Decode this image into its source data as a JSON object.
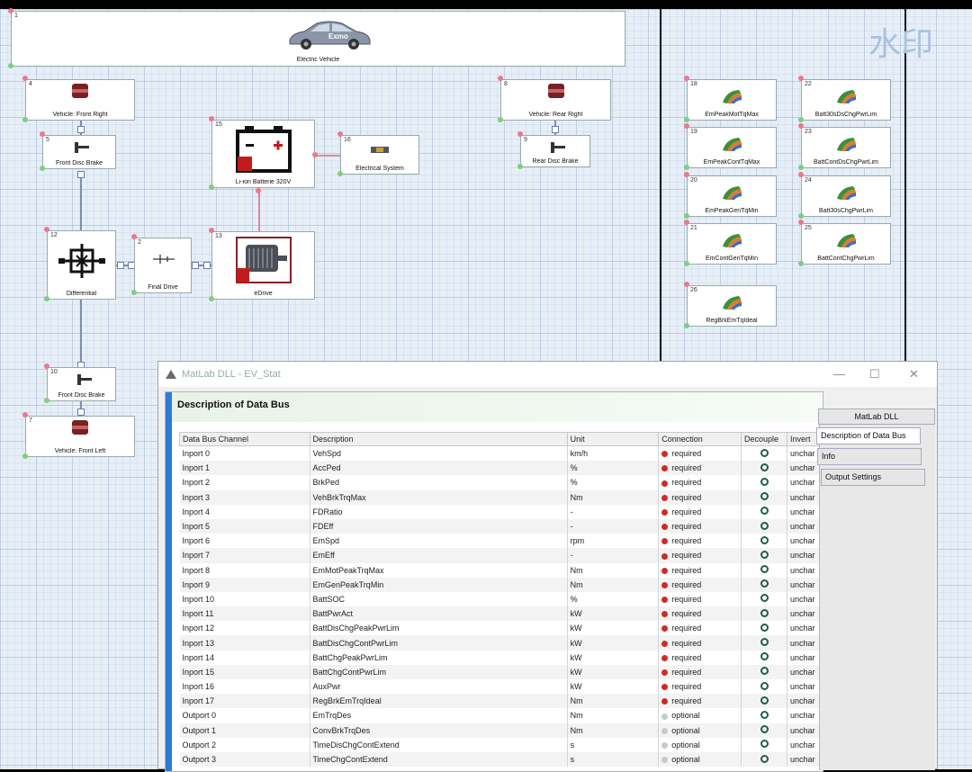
{
  "canvas": {
    "watermark": "水印",
    "top_banner": {
      "num": "1",
      "label": "Electric Vehicle",
      "car_text": "Exmo"
    },
    "blocks": [
      {
        "num": "4",
        "label": "Vehicle: Front Right"
      },
      {
        "num": "5",
        "label": "Front Disc Brake"
      },
      {
        "num": "8",
        "label": "Vehicle: Rear Right"
      },
      {
        "num": "9",
        "label": "Rear Disc Brake"
      },
      {
        "num": "15",
        "label": "Li-ion Batterie 320V"
      },
      {
        "num": "16",
        "label": "Electrical System"
      },
      {
        "num": "12",
        "label": "Differential"
      },
      {
        "num": "2",
        "label": "Final Drive"
      },
      {
        "num": "13",
        "label": "eDrive"
      },
      {
        "num": "10",
        "label": "Front Disc Brake"
      },
      {
        "num": "7",
        "label": "Vehicle: Front Left"
      }
    ],
    "logic_blocks": [
      {
        "num": "18",
        "label": "EmPeakMotTqMax"
      },
      {
        "num": "22",
        "label": "Batt30sDsChgPwrLim"
      },
      {
        "num": "19",
        "label": "EmPeakContTqMax"
      },
      {
        "num": "23",
        "label": "BattContDsChgPwrLim"
      },
      {
        "num": "20",
        "label": "EmPeakGenTqMin"
      },
      {
        "num": "24",
        "label": "Batt30sChgPwrLim"
      },
      {
        "num": "21",
        "label": "EmContGenTqMin"
      },
      {
        "num": "25",
        "label": "BattContChgPwrLim"
      },
      {
        "num": "26",
        "label": "RegBrkEmTqIdeal"
      }
    ]
  },
  "dialog": {
    "title": "MatLab DLL - EV_Stat",
    "heading": "Description of Data Bus",
    "tabs": [
      "MatLab DLL",
      "Description of Data Bus",
      "Info",
      "Output Settings"
    ],
    "columns": [
      "Data Bus Channel",
      "Description",
      "Unit",
      "Connection",
      "Decouple",
      "Invert"
    ],
    "rows": [
      {
        "channel": "Inport 0",
        "description": "VehSpd",
        "unit": "km/h",
        "connection": "required",
        "invert": "unchar"
      },
      {
        "channel": "Inport 1",
        "description": "AccPed",
        "unit": "%",
        "connection": "required",
        "invert": "unchar"
      },
      {
        "channel": "Inport 2",
        "description": "BrkPed",
        "unit": "%",
        "connection": "required",
        "invert": "unchar"
      },
      {
        "channel": "Inport 3",
        "description": "VehBrkTrqMax",
        "unit": "Nm",
        "connection": "required",
        "invert": "unchar"
      },
      {
        "channel": "Inport 4",
        "description": "FDRatio",
        "unit": "-",
        "connection": "required",
        "invert": "unchar"
      },
      {
        "channel": "Inport 5",
        "description": "FDEff",
        "unit": "-",
        "connection": "required",
        "invert": "unchar"
      },
      {
        "channel": "Inport 6",
        "description": "EmSpd",
        "unit": "rpm",
        "connection": "required",
        "invert": "unchar"
      },
      {
        "channel": "Inport 7",
        "description": "EmEff",
        "unit": "-",
        "connection": "required",
        "invert": "unchar"
      },
      {
        "channel": "Inport 8",
        "description": "EmMotPeakTrqMax",
        "unit": "Nm",
        "connection": "required",
        "invert": "unchar"
      },
      {
        "channel": "Inport 9",
        "description": "EmGenPeakTrqMin",
        "unit": "Nm",
        "connection": "required",
        "invert": "unchar"
      },
      {
        "channel": "Inport 10",
        "description": "BattSOC",
        "unit": "%",
        "connection": "required",
        "invert": "unchar"
      },
      {
        "channel": "Inport 11",
        "description": "BattPwrAct",
        "unit": "kW",
        "connection": "required",
        "invert": "unchar"
      },
      {
        "channel": "Inport 12",
        "description": "BattDisChgPeakPwrLim",
        "unit": "kW",
        "connection": "required",
        "invert": "unchar"
      },
      {
        "channel": "Inport 13",
        "description": "BattDisChgContPwrLim",
        "unit": "kW",
        "connection": "required",
        "invert": "unchar"
      },
      {
        "channel": "Inport 14",
        "description": "BattChgPeakPwrLim",
        "unit": "kW",
        "connection": "required",
        "invert": "unchar"
      },
      {
        "channel": "Inport 15",
        "description": "BattChgContPwrLim",
        "unit": "kW",
        "connection": "required",
        "invert": "unchar"
      },
      {
        "channel": "Inport 16",
        "description": "AuxPwr",
        "unit": "kW",
        "connection": "required",
        "invert": "unchar"
      },
      {
        "channel": "Inport 17",
        "description": "RegBrkEmTrqIdeal",
        "unit": "Nm",
        "connection": "required",
        "invert": "unchar"
      },
      {
        "channel": "Outport 0",
        "description": "EmTrqDes",
        "unit": "Nm",
        "connection": "optional",
        "invert": "unchar"
      },
      {
        "channel": "Outport 1",
        "description": "ConvBrkTrqDes",
        "unit": "Nm",
        "connection": "optional",
        "invert": "unchar"
      },
      {
        "channel": "Outport 2",
        "description": "TimeDisChgContExtend",
        "unit": "s",
        "connection": "optional",
        "invert": "unchar"
      },
      {
        "channel": "Outport 3",
        "description": "TimeChgContExtend",
        "unit": "s",
        "connection": "optional",
        "invert": "unchar"
      }
    ]
  }
}
